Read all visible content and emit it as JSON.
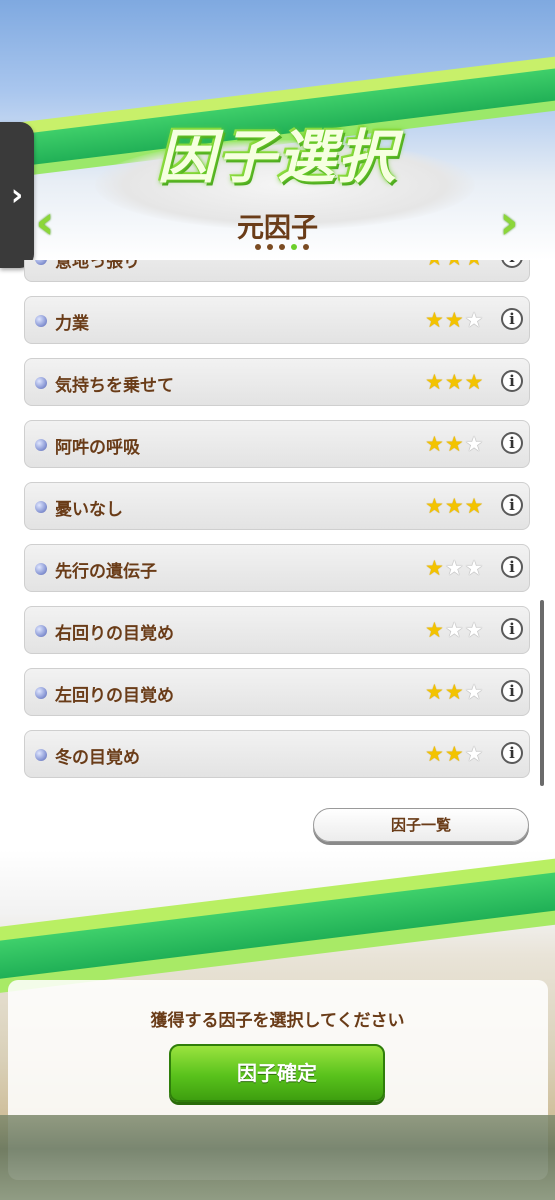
{
  "header": {
    "title": "因子選択",
    "subtitle": "元因子",
    "page_count": 5,
    "active_page": 4,
    "prev_arrow": "‹",
    "next_arrow": "›",
    "side_tab_glyph": "›"
  },
  "factors": [
    {
      "label": "意地っ張り",
      "stars": 3
    },
    {
      "label": "力業",
      "stars": 2
    },
    {
      "label": "気持ちを乗せて",
      "stars": 3
    },
    {
      "label": "阿吽の呼吸",
      "stars": 2
    },
    {
      "label": "憂いなし",
      "stars": 3
    },
    {
      "label": "先行の遺伝子",
      "stars": 1
    },
    {
      "label": "右回りの目覚め",
      "stars": 1
    },
    {
      "label": "左回りの目覚め",
      "stars": 2
    },
    {
      "label": "冬の目覚め",
      "stars": 2
    }
  ],
  "max_stars": 3,
  "info_glyph": "i",
  "buttons": {
    "factor_list": "因子一覧",
    "confirm": "因子確定"
  },
  "prompt": "獲得する因子を選択してください",
  "colors": {
    "text_brown": "#6a3c18",
    "accent_green": "#59c21c",
    "star_gold": "#f3c300"
  }
}
